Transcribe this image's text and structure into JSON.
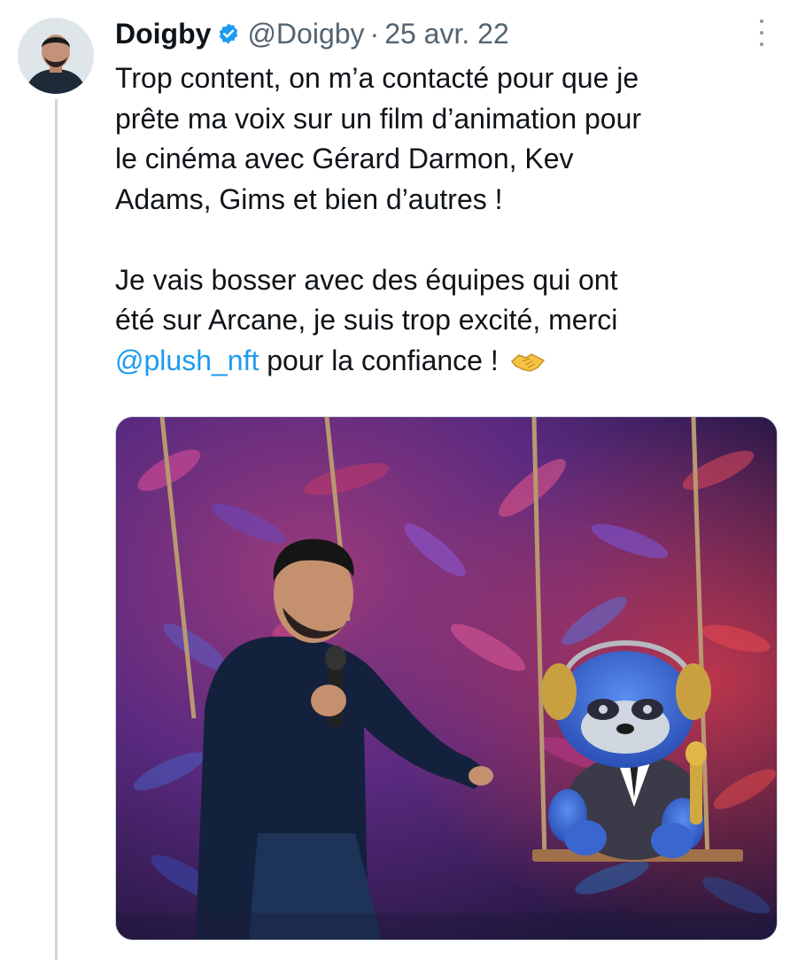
{
  "tweet": {
    "author": {
      "display_name": "Doigby",
      "handle": "@Doigby",
      "verified": true,
      "verified_color": "#1d9bf0"
    },
    "separator": "·",
    "date": "25 avr. 22",
    "text": {
      "line1": "Trop content, on m’a contacté pour que je",
      "line2": "prête ma voix sur un film d’animation pour",
      "line3": "le cinéma avec Gérard Darmon, Kev",
      "line4": "Adams, Gims et bien d’autres !",
      "line5": "Je vais bosser avec des équipes qui ont",
      "line6": "été sur Arcane, je suis trop excité, merci",
      "mention": "@plush_nft",
      "line7_rest": "pour la confiance !",
      "emoji": "handshake-icon"
    },
    "mention_color": "#1d9bf0",
    "media_alt": "Photo: man with microphone next to a blue teddy bear with gold headphones on a swing in front of a flower wall"
  }
}
